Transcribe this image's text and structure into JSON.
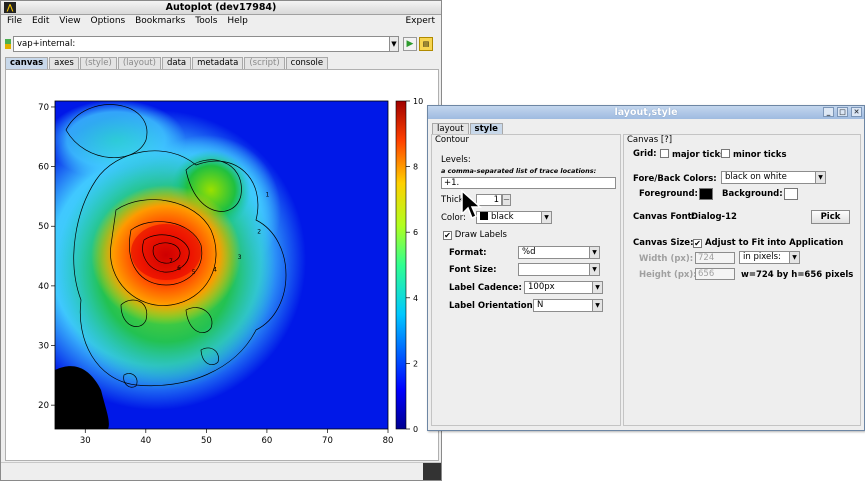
{
  "main_window": {
    "title": "Autoplot (dev17984)",
    "menu": [
      "File",
      "Edit",
      "View",
      "Options",
      "Bookmarks",
      "Tools",
      "Help"
    ],
    "menu_right": "Expert",
    "url": "vap+internal:",
    "tabs": [
      {
        "label": "canvas",
        "state": "active"
      },
      {
        "label": "axes",
        "state": "normal"
      },
      {
        "label": "(style)",
        "state": "disabled"
      },
      {
        "label": "(layout)",
        "state": "disabled"
      },
      {
        "label": "data",
        "state": "normal"
      },
      {
        "label": "metadata",
        "state": "normal"
      },
      {
        "label": "(script)",
        "state": "disabled"
      },
      {
        "label": "console",
        "state": "normal"
      }
    ]
  },
  "chart_data": {
    "type": "heatmap",
    "x_ticks": [
      "30",
      "40",
      "50",
      "60",
      "70",
      "80"
    ],
    "y_ticks": [
      "20",
      "30",
      "40",
      "50",
      "60",
      "70"
    ],
    "xlim": [
      25,
      80
    ],
    "ylim": [
      16,
      71
    ],
    "colorbar_ticks": [
      "0",
      "2",
      "4",
      "6",
      "8",
      "10"
    ],
    "colorbar_range": [
      0,
      10
    ],
    "contour_labels": [
      "1",
      "2",
      "3",
      "4",
      "5",
      "6",
      "7"
    ],
    "peak": {
      "x": 44,
      "y": 45.5,
      "value": 9.5
    }
  },
  "dialog": {
    "title": "layout,style",
    "tabs": [
      {
        "label": "layout",
        "state": "normal"
      },
      {
        "label": "style",
        "state": "active"
      }
    ],
    "contour": {
      "header": "Contour",
      "levels_label": "Levels:",
      "levels_hint": "a comma-separated list of trace locations:",
      "levels_value": "+1.",
      "thick_label": "Thick",
      "thick_value": "1",
      "color_label": "Color:",
      "color_value": "black",
      "draw_labels_label": "Draw Labels",
      "draw_labels_checked": true,
      "format_label": "Format:",
      "format_value": "%d",
      "font_size_label": "Font Size:",
      "font_size_value": "",
      "cadence_label": "Label Cadence:",
      "cadence_value": "100px",
      "orientation_label": "Label Orientation:",
      "orientation_value": "N"
    },
    "canvas": {
      "header": "Canvas [?]",
      "grid_label": "Grid:",
      "major_ticks_label": "major ticks",
      "minor_ticks_label": "minor ticks",
      "fore_back_label": "Fore/Back Colors:",
      "fore_back_value": "black on white",
      "foreground_label": "Foreground:",
      "foreground_color": "#000000",
      "background_label": "Background:",
      "background_color": "#ffffff",
      "font_label": "Canvas Font:",
      "font_value": "Dialog-12",
      "pick_label": "Pick",
      "size_label": "Canvas Size:",
      "adjust_label": "Adjust to Fit into Application",
      "adjust_checked": true,
      "width_label": "Width (px):",
      "width_value": "724",
      "units_value": "in pixels:",
      "height_label": "Height (px):",
      "height_value": "656",
      "size_readout": "w=724 by h=656 pixels"
    }
  }
}
